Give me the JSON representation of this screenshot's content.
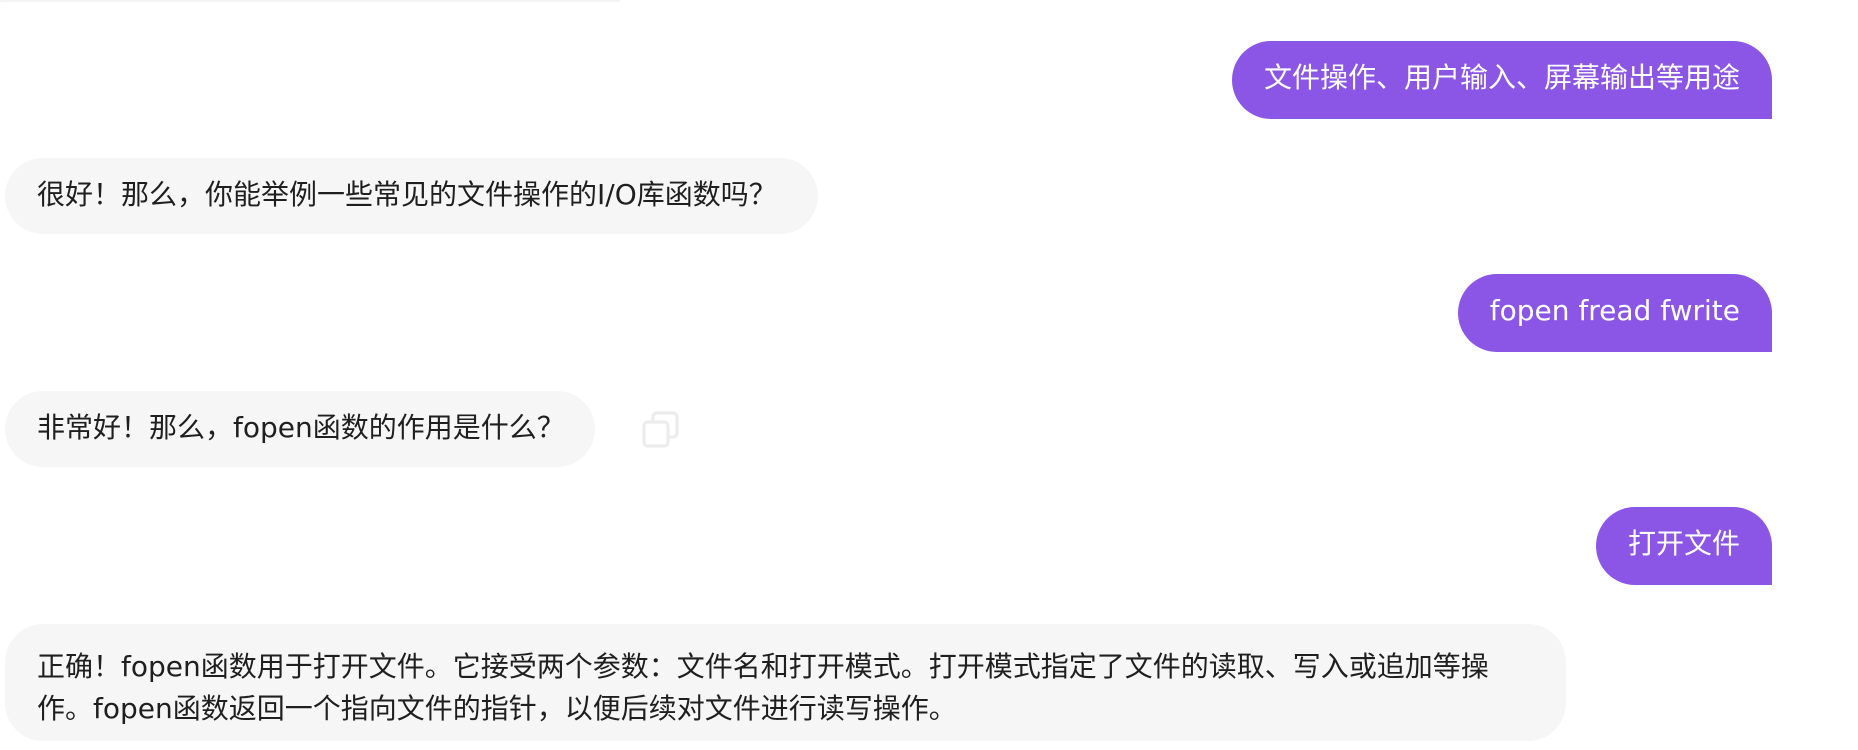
{
  "colors": {
    "user_bubble": "#8b55e6",
    "ai_bubble": "#f6f6f6",
    "copy_icon": "#9a9a9a"
  },
  "messages": [
    {
      "role": "user",
      "text": "文件操作、用户输入、屏幕输出等用途"
    },
    {
      "role": "assistant",
      "text": "很好！那么，你能举例一些常见的文件操作的I/O库函数吗？"
    },
    {
      "role": "user",
      "text": "fopen fread fwrite",
      "icon": "copy-icon"
    },
    {
      "role": "assistant",
      "text": "非常好！那么，fopen函数的作用是什么？",
      "icon": "copy-icon"
    },
    {
      "role": "user",
      "text": "打开文件"
    },
    {
      "role": "assistant",
      "text": "正确！fopen函数用于打开文件。它接受两个参数：文件名和打开模式。打开模式指定了文件的读取、写入或追加等操作。fopen函数返回一个指向文件的指针，以便后续对文件进行读写操作。"
    }
  ]
}
